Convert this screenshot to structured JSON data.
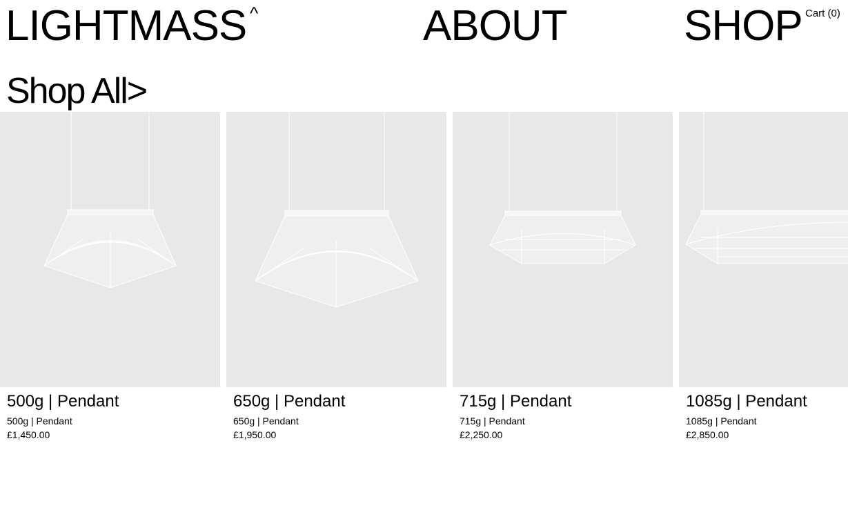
{
  "header": {
    "brand": "LIGHTMASS",
    "brand_caret": "^",
    "nav_about": "ABOUT",
    "nav_shop": "SHOP",
    "cart": "Cart (0)"
  },
  "section": {
    "title": "Shop All>"
  },
  "products": [
    {
      "name": "500g | Pendant",
      "subtitle": "500g | Pendant",
      "price": "£1,450.00",
      "image_icon": "pendant-lamp-image"
    },
    {
      "name": "650g | Pendant",
      "subtitle": "650g | Pendant",
      "price": "£1,950.00",
      "image_icon": "pendant-lamp-image"
    },
    {
      "name": "715g | Pendant",
      "subtitle": "715g | Pendant",
      "price": "£2,250.00",
      "image_icon": "pendant-lamp-image"
    },
    {
      "name": "1085g | Pendant",
      "subtitle": "1085g | Pendant",
      "price": "£2,850.00",
      "image_icon": "pendant-lamp-image"
    }
  ],
  "colors": {
    "background": "#ffffff",
    "image_background": "#e8e8e8",
    "text": "#000000",
    "lamp_stroke": "#ffffff"
  }
}
